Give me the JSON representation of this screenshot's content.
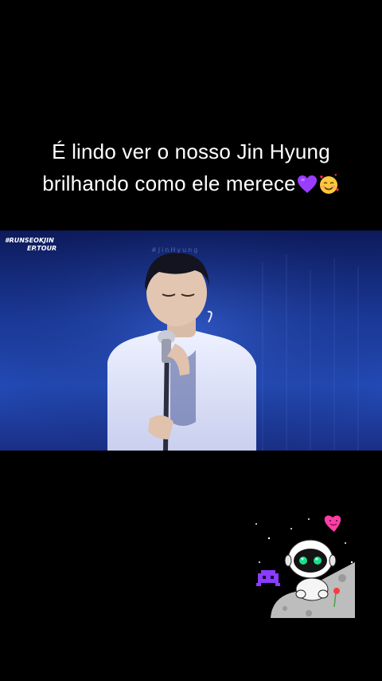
{
  "caption": {
    "line1": "É lindo ver o nosso Jin Hyung",
    "line2": "brilhando como ele merece",
    "emojis": [
      "purple-heart",
      "smiling-face-with-hearts"
    ]
  },
  "video": {
    "logo_line1": "#RUNSEOKJIN",
    "logo_line2": "EP.TOUR",
    "watermark": "#JinHyung"
  },
  "sticker": {
    "name": "astronaut-robot-sticker",
    "colors": {
      "heart": "#ff3ea5",
      "alien": "#8a3cff",
      "eyes": "#19e08a",
      "moon": "#bdbdbd"
    }
  },
  "colors": {
    "background": "#000000",
    "stage_blue": "#234cb8",
    "text": "#ffffff"
  }
}
